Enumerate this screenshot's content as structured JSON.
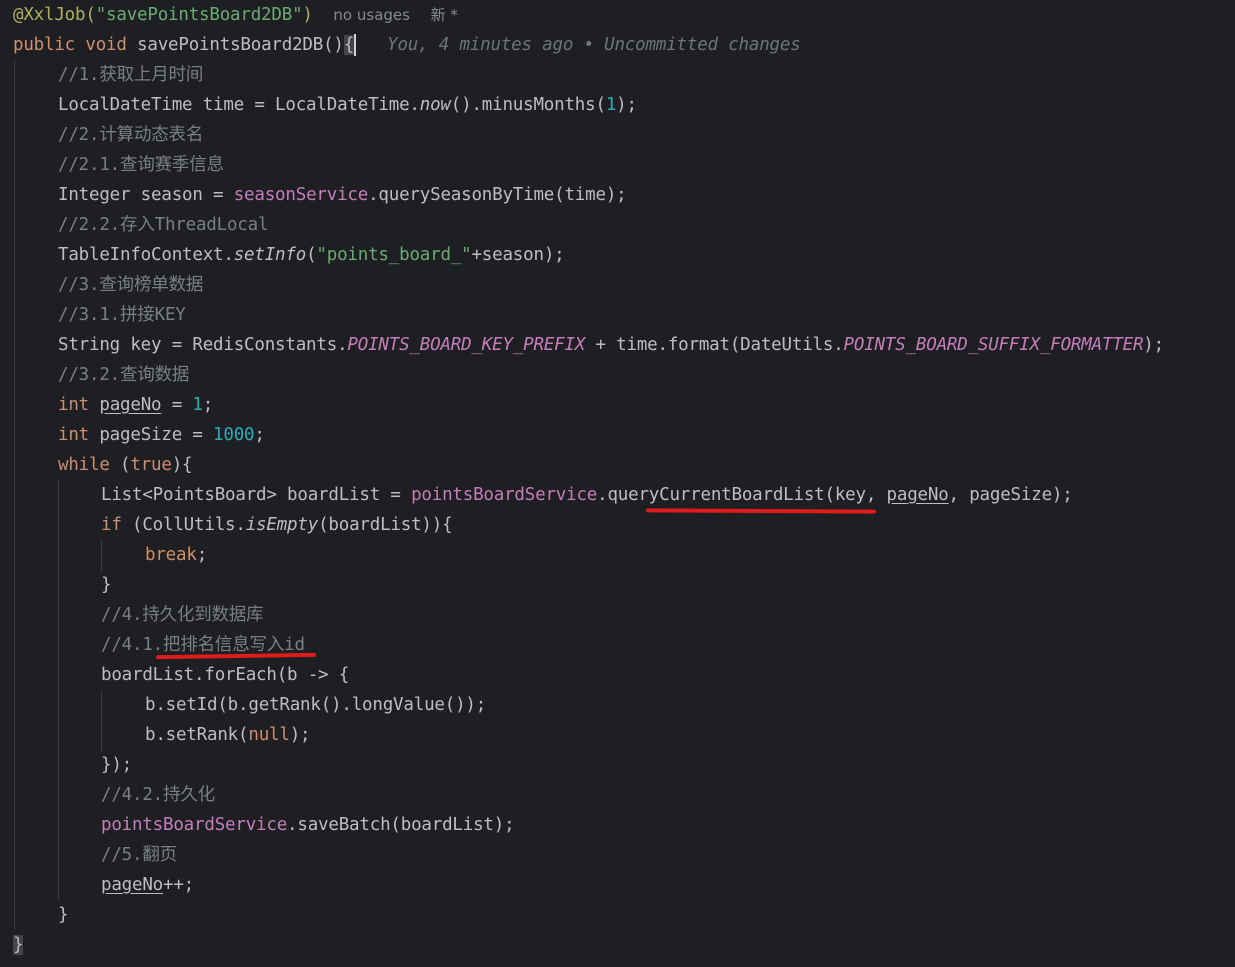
{
  "annotation": {
    "text": "@XxlJob(",
    "arg": "\"savePointsBoard2DB\"",
    "close": ")",
    "usages": "no usages",
    "new_marker": "新 *"
  },
  "signature": {
    "public": "public",
    "void": "void",
    "name": "savePointsBoard2DB",
    "parens": "()",
    "brace": "{",
    "blame": "You, 4 minutes ago • Uncommitted changes"
  },
  "lines": {
    "c1": "//1.获取上月时间",
    "l_time_a": "LocalDateTime time = LocalDateTime.",
    "l_time_now": "now",
    "l_time_b": "().minusMonths(",
    "l_time_num": "1",
    "l_time_c": ");",
    "c2": "//2.计算动态表名",
    "c21": "//2.1.查询赛季信息",
    "l_season_a": "Integer season = ",
    "l_season_svc": "seasonService",
    "l_season_b": ".querySeasonByTime(time);",
    "c22": "//2.2.存入ThreadLocal",
    "l_ctx_a": "TableInfoContext.",
    "l_ctx_set": "setInfo",
    "l_ctx_b": "(",
    "l_ctx_str": "\"points_board_\"",
    "l_ctx_c": "+season);",
    "c3": "//3.查询榜单数据",
    "c31": "//3.1.拼接KEY",
    "l_key_a": "String key = RedisConstants.",
    "l_key_const": "POINTS_BOARD_KEY_PREFIX",
    "l_key_b": " + time.format(DateUtils.",
    "l_key_const2": "POINTS_BOARD_SUFFIX_FORMATTER",
    "l_key_c": ");",
    "c32": "//3.2.查询数据",
    "l_pno_kw": "int",
    "l_pno_var": "pageNo",
    "l_pno_a": " = ",
    "l_pno_num": "1",
    "l_pno_b": ";",
    "l_psz_kw": "int",
    "l_psz_a": " pageSize = ",
    "l_psz_num": "1000",
    "l_psz_b": ";",
    "l_while_kw": "while",
    "l_while_a": " (",
    "l_while_true": "true",
    "l_while_b": "){",
    "l_list_a": "List<PointsBoard> boardList = ",
    "l_list_svc": "pointsBoardService",
    "l_list_b": ".queryCurrentBoardList(key, ",
    "l_list_var": "pageNo",
    "l_list_c": ", pageSize);",
    "l_if_kw": "if",
    "l_if_a": " (CollUtils.",
    "l_if_fn": "isEmpty",
    "l_if_b": "(boardList)){",
    "l_break": "break",
    "l_break_semi": ";",
    "l_close1": "}",
    "c4": "//4.持久化到数据库",
    "c41": "//4.1.把排名信息写入id",
    "l_foreach": "boardList.forEach(b -> {",
    "l_setid": "b.setId(b.getRank().longValue());",
    "l_setrank_a": "b.setRank(",
    "l_setrank_null": "null",
    "l_setrank_b": ");",
    "l_close2": "});",
    "c42": "//4.2.持久化",
    "l_save_svc": "pointsBoardService",
    "l_save_b": ".saveBatch(boardList);",
    "c5": "//5.翻页",
    "l_inc_var": "pageNo",
    "l_inc_b": "++;",
    "l_close3": "}",
    "l_close4": "}"
  },
  "colors": {
    "background": "#1e1f22",
    "keyword": "#cf8e6d",
    "string": "#6aab73",
    "number": "#2aacb8",
    "comment": "#7a7e85",
    "field": "#c77dbb",
    "annotation": "#b3ae60",
    "method_decl": "#56a8f5",
    "red_underline": "#e01b1b"
  }
}
